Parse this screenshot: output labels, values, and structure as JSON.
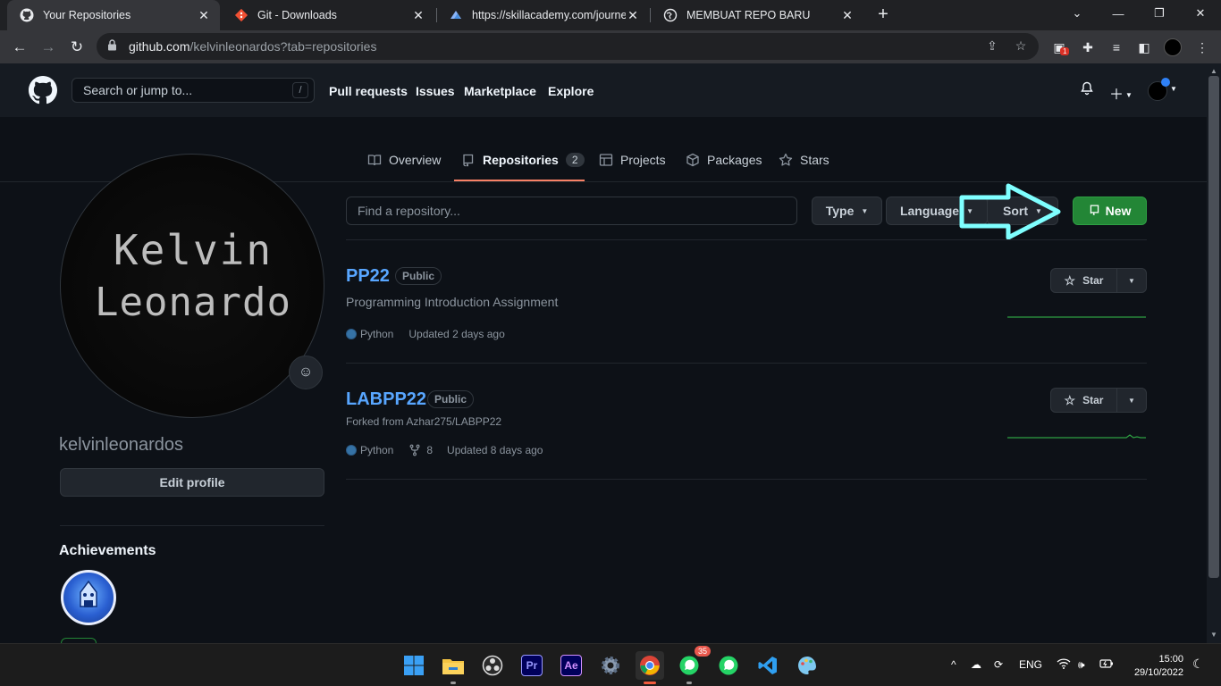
{
  "browser": {
    "tabs": [
      {
        "title": "Your Repositories",
        "icon": "github-icon",
        "active": true
      },
      {
        "title": "Git - Downloads",
        "icon": "git-icon",
        "active": false
      },
      {
        "title": "https://skillacademy.com/journey",
        "icon": "skillacademy-icon",
        "active": false
      },
      {
        "title": "MEMBUAT REPO BARU",
        "icon": "globe-icon",
        "active": false
      }
    ],
    "url_host": "github.com",
    "url_path": "/kelvinleonardos?tab=repositories",
    "extension_badge": "1"
  },
  "gh_header": {
    "search_placeholder": "Search or jump to...",
    "search_shortcut": "/",
    "nav": [
      "Pull requests",
      "Issues",
      "Marketplace",
      "Explore"
    ]
  },
  "profile_nav": {
    "overview": "Overview",
    "repositories": "Repositories",
    "repositories_count": "2",
    "projects": "Projects",
    "packages": "Packages",
    "stars": "Stars"
  },
  "profile": {
    "avatar_line1": "Kelvin",
    "avatar_line2": "Leonardo",
    "username": "kelvinleonardos",
    "edit_label": "Edit profile",
    "achievements_title": "Achievements"
  },
  "repo_filter": {
    "find_placeholder": "Find a repository...",
    "type_label": "Type",
    "language_label": "Language",
    "sort_label": "Sort",
    "new_label": "New"
  },
  "repos": [
    {
      "name": "PP22",
      "visibility": "Public",
      "description": "Programming Introduction Assignment",
      "language": "Python",
      "updated": "Updated 2 days ago",
      "star_label": "Star"
    },
    {
      "name": "LABPP22",
      "visibility": "Public",
      "forked_from": "Forked from Azhar275/LABPP22",
      "language": "Python",
      "forks": "8",
      "updated": "Updated 8 days ago",
      "star_label": "Star"
    }
  ],
  "taskbar": {
    "whatsapp_badge": "35",
    "language": "ENG",
    "time": "15:00",
    "date": "29/10/2022"
  },
  "colors": {
    "accent_green": "#238636",
    "link_blue": "#58a6ff",
    "python": "#3572A5",
    "tab_underline": "#f78166",
    "annotation_arrow": "#7fffff"
  }
}
